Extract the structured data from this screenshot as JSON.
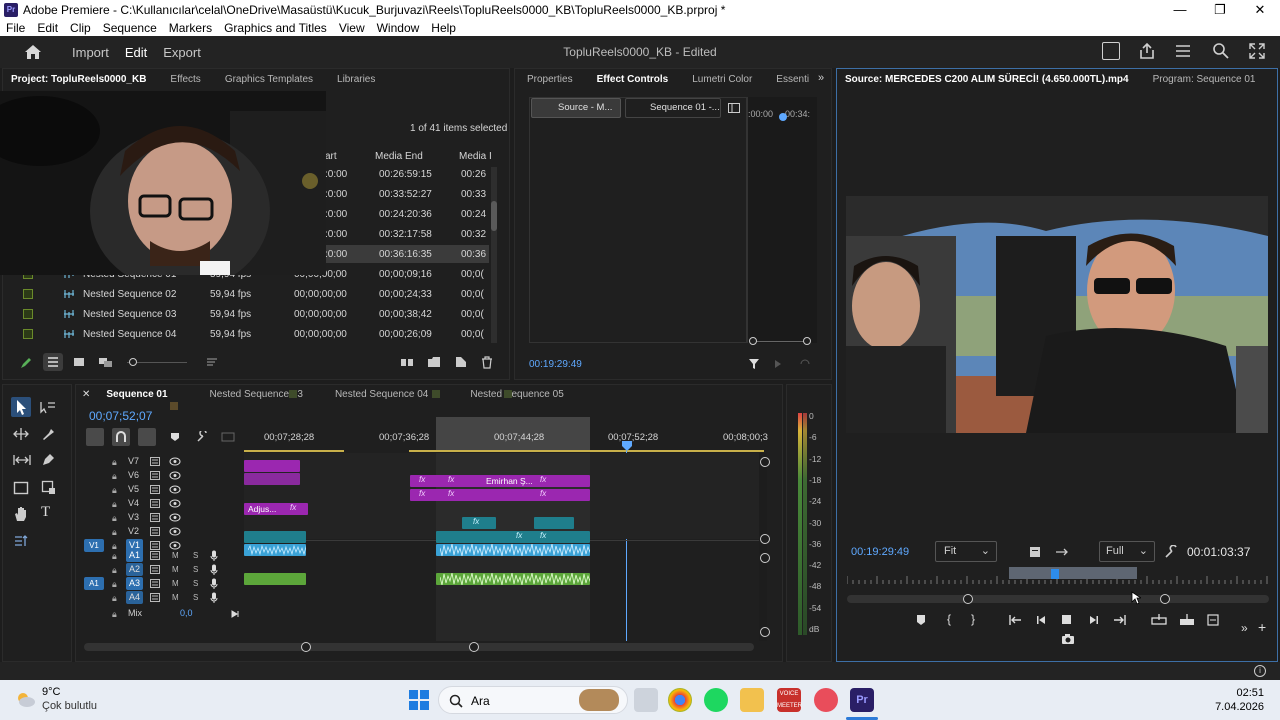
{
  "window": {
    "title": "Adobe Premiere - C:\\Kullanıcılar\\celal\\OneDrive\\Masaüstü\\Kucuk_Burjuvazi\\Reels\\TopluReels0000_KB\\TopluReels0000_KB.prproj *",
    "logo_text": "Pr",
    "buttons": [
      "—",
      "❐",
      "✕"
    ]
  },
  "menu": [
    "File",
    "Edit",
    "Clip",
    "Sequence",
    "Markers",
    "Graphics and Titles",
    "View",
    "Window",
    "Help"
  ],
  "header": {
    "nav": [
      "Import",
      "Edit",
      "Export"
    ],
    "active_nav": "Edit",
    "document_title": "TopluReels0000_KB - Edited"
  },
  "project_panel": {
    "tabs": [
      "Project: TopluReels0000_KB",
      "Effects",
      "Graphics Templates",
      "Libraries"
    ],
    "selection_status": "1 of 41 items selected",
    "columns": [
      "art",
      "Media End",
      "Media I"
    ],
    "top_rows": [
      {
        "start": ":0:00",
        "end": "00:26:59:15",
        "dur": "00:26"
      },
      {
        "start": ":0:00",
        "end": "00:33:52:27",
        "dur": "00:33"
      },
      {
        "start": ":0:00",
        "end": "00:24:20:36",
        "dur": "00:24"
      },
      {
        "start": ":0:00",
        "end": "00:32:17:58",
        "dur": "00:32"
      },
      {
        "start": ":0:00",
        "end": "00:36:16:35",
        "dur": "00:36"
      }
    ],
    "sequence_rows": [
      {
        "name": "Nested Sequence 01",
        "fps": "59,94 fps",
        "start": "00;00;00;00",
        "end": "00;00;09;16",
        "dur": "00;0("
      },
      {
        "name": "Nested Sequence 02",
        "fps": "59,94 fps",
        "start": "00;00;00;00",
        "end": "00;00;24;33",
        "dur": "00;0("
      },
      {
        "name": "Nested Sequence 03",
        "fps": "59,94 fps",
        "start": "00;00;00;00",
        "end": "00;00;38;42",
        "dur": "00;0("
      },
      {
        "name": "Nested Sequence 04",
        "fps": "59,94 fps",
        "start": "00;00;00;00",
        "end": "00;00;26;09",
        "dur": "00;0("
      }
    ]
  },
  "effect_panel": {
    "tabs": [
      "Properties",
      "Effect Controls",
      "Lumetri Color",
      "Essenti"
    ],
    "source_button": "Source - M...",
    "sequence_button": "Sequence 01 -...",
    "ruler_left": ":00:00",
    "ruler_right": "00:34:",
    "timecode": "00:19:29:49"
  },
  "source_monitor": {
    "tab_source": "Source: MERCEDES C200 ALIM SÜRECİ! (4.650.000TL).mp4",
    "tab_program": "Program: Sequence 01",
    "timecode": "00:19:29:49",
    "fit": "Fit",
    "quality": "Full",
    "duration": "00:01:03:37"
  },
  "timeline": {
    "tabs": [
      "Sequence 01",
      "Nested Sequence 03",
      "Nested Sequence 04",
      "Nested Sequence 05"
    ],
    "timecode": "00;07;52;07",
    "ruler": [
      "00;07;28;28",
      "00;07;36;28",
      "00;07;44;28",
      "00;07;52;28",
      "00;08;00;3"
    ],
    "video_tracks": [
      "V7",
      "V6",
      "V5",
      "V4",
      "V3",
      "V2",
      "V1"
    ],
    "audio_tracks": [
      "A1",
      "A2",
      "A3",
      "A4"
    ],
    "mix_label": "Mix",
    "mix_value": "0,0",
    "source_patch_v": "V1",
    "source_patch_a": "A1",
    "clip_labels": {
      "emirhan": "Emirhan Ş...",
      "adjust": "Adjus..."
    },
    "fx": "fx"
  },
  "audio_meter": {
    "scale": [
      "0",
      "-6",
      "-12",
      "-18",
      "-24",
      "-30",
      "-36",
      "-42",
      "-48",
      "-54",
      "dB"
    ]
  },
  "taskbar": {
    "weather_temp": "9°C",
    "weather_desc": "Çok bulutlu",
    "search": "Ara",
    "time": "02:51",
    "date": "7.04.2026",
    "voicemeeter": "VOICE MEETER"
  },
  "colors": {
    "accent_blue": "#2d8ceb",
    "timecode_blue": "#5fa9ff",
    "clip_purple": "#9b27b0",
    "clip_teal": "#1f7e8c",
    "audio_blue": "#3aa2d6",
    "audio_green": "#5ca63a"
  }
}
